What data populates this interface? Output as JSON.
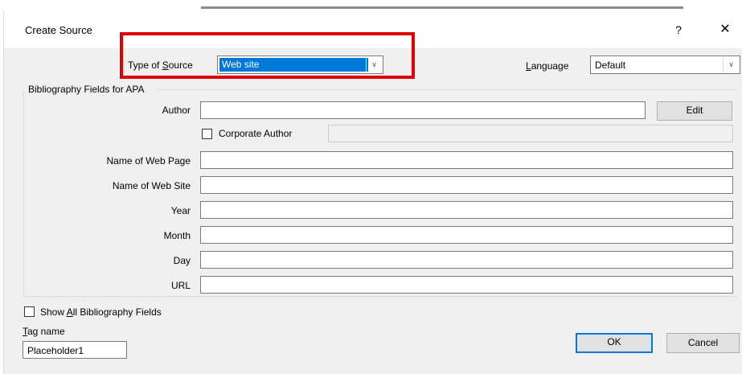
{
  "dialog": {
    "title": "Create Source",
    "help_label": "?",
    "close_label": "✕"
  },
  "type_of_source": {
    "label_pre": "Type of ",
    "label_key": "S",
    "label_post": "ource",
    "value": "Web site"
  },
  "language": {
    "label_key": "L",
    "label_post": "anguage",
    "value": "Default"
  },
  "group_title": "Bibliography Fields for APA",
  "fields": {
    "author": {
      "label": "Author",
      "value": ""
    },
    "corporate_author": {
      "label": "Corporate Author",
      "checked": false,
      "value": ""
    },
    "name_of_web_page": {
      "label": "Name of Web Page",
      "value": ""
    },
    "name_of_web_site": {
      "label": "Name of Web Site",
      "value": ""
    },
    "year": {
      "label": "Year",
      "value": ""
    },
    "month": {
      "label": "Month",
      "value": ""
    },
    "day": {
      "label": "Day",
      "value": ""
    },
    "url": {
      "label": "URL",
      "value": ""
    }
  },
  "buttons": {
    "edit": "Edit",
    "ok": "OK",
    "cancel": "Cancel"
  },
  "show_all": {
    "label_pre": "Show ",
    "label_key": "A",
    "label_post": "ll Bibliography Fields",
    "checked": false
  },
  "tag": {
    "label_key": "T",
    "label_post": "ag name",
    "value": "Placeholder1"
  },
  "colors": {
    "highlight": "#e00000",
    "selection": "#0078d7",
    "dialog_bg": "#f0f0f0"
  }
}
